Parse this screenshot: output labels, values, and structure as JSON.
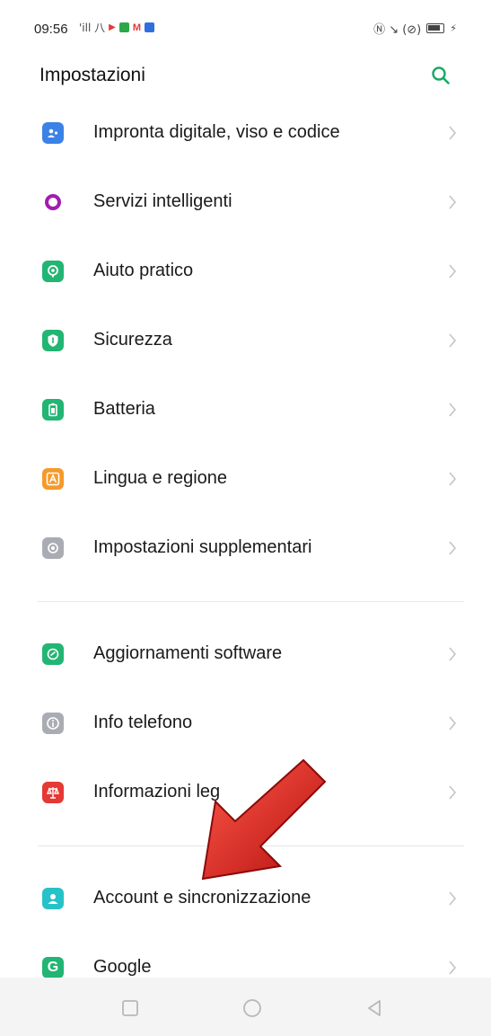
{
  "status_bar": {
    "time": "09:56",
    "signal_text": "'ill 八",
    "right_text": "Ⓝ ↘ (⊘)"
  },
  "header": {
    "title": "Impostazioni"
  },
  "colors": {
    "accent": "#1aa865"
  },
  "sections": [
    {
      "items": [
        {
          "label": "Impronta digitale, viso e codice",
          "icon": "fingerprint-face-icon",
          "color": "#3b82e6"
        },
        {
          "label": "Servizi intelligenti",
          "icon": "smart-services-icon",
          "color": "#a21caf"
        },
        {
          "label": "Aiuto pratico",
          "icon": "assistant-icon",
          "color": "#22b573"
        },
        {
          "label": "Sicurezza",
          "icon": "shield-icon",
          "color": "#22b573"
        },
        {
          "label": "Batteria",
          "icon": "battery-icon",
          "color": "#22b573"
        },
        {
          "label": "Lingua e regione",
          "icon": "language-icon",
          "color": "#f59a2a"
        },
        {
          "label": "Impostazioni supplementari",
          "icon": "extra-settings-icon",
          "color": "#a9adb3"
        }
      ]
    },
    {
      "items": [
        {
          "label": "Aggiornamenti software",
          "icon": "update-icon",
          "color": "#22b573"
        },
        {
          "label": "Info telefono",
          "icon": "info-icon",
          "color": "#a9adb3"
        },
        {
          "label": "Informazioni leg",
          "icon": "legal-scale-icon",
          "color": "#e53935"
        }
      ]
    },
    {
      "items": [
        {
          "label": "Account e sincronizzazione",
          "icon": "account-icon",
          "color": "#26c2c8"
        },
        {
          "label": "Google",
          "icon": "google-icon",
          "color": "#22b573"
        }
      ]
    }
  ]
}
